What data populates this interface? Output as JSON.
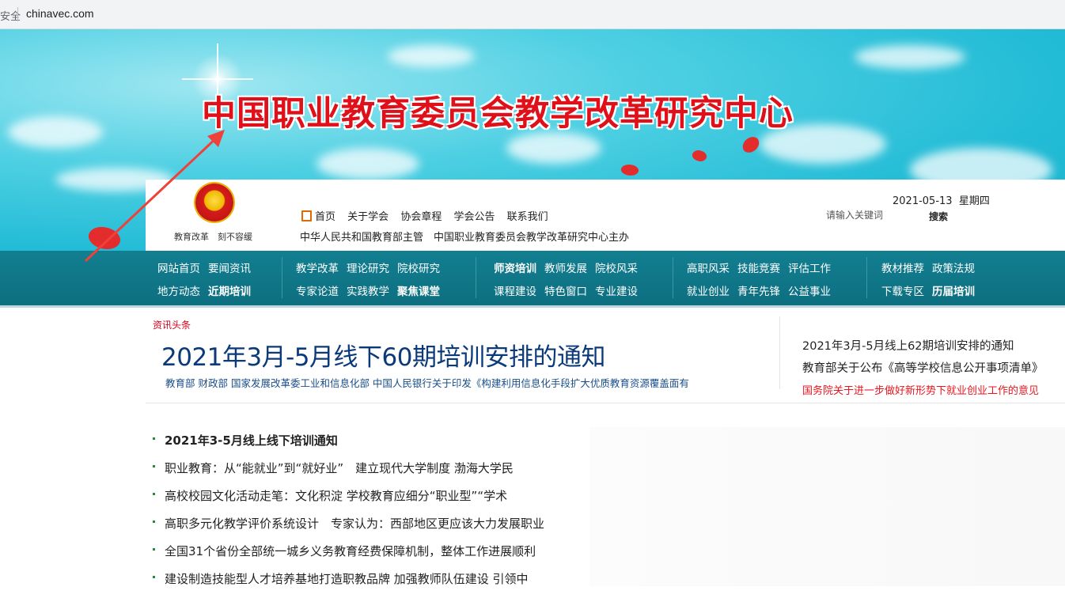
{
  "browser": {
    "security_text": "安全",
    "url": "chinavec.com"
  },
  "banner": {
    "title": "中国职业教育委员会教学改革研究中心"
  },
  "header": {
    "emblem_caption": "教育改革　刻不容缓",
    "nav": [
      {
        "label": "首页"
      },
      {
        "label": "关于学会"
      },
      {
        "label": "协会章程"
      },
      {
        "label": "学会公告"
      },
      {
        "label": "联系我们"
      }
    ],
    "sub_text": "中华人民共和国教育部主管　中国职业教育委员会教学改革研究中心主办",
    "date": "2021-05-13",
    "weekday": "星期四",
    "search_placeholder": "请输入关键词",
    "search_button": "搜索"
  },
  "navbar": {
    "groups": [
      {
        "row1": [
          "网站首页",
          "要闻资讯"
        ],
        "row2": [
          "地方动态",
          "近期培训"
        ]
      },
      {
        "row1": [
          "教学改革",
          "理论研究",
          "院校研究"
        ],
        "row2": [
          "专家论道",
          "实践教学",
          "聚焦课堂"
        ]
      },
      {
        "row1": [
          "师资培训",
          "教师发展",
          "院校风采"
        ],
        "row2": [
          "课程建设",
          "特色窗口",
          "专业建设"
        ]
      },
      {
        "row1": [
          "高职风采",
          "技能竞赛",
          "评估工作"
        ],
        "row2": [
          "就业创业",
          "青年先锋",
          "公益事业"
        ]
      },
      {
        "row1": [
          "教材推荐",
          "政策法规"
        ],
        "row2": [
          "下载专区",
          "历届培训"
        ]
      }
    ]
  },
  "headline": {
    "tag": "资讯头条",
    "title": "2021年3月-5月线下60期培训安排的通知",
    "subtitle": "教育部 财政部 国家发展改革委工业和信息化部 中国人民银行关于印发《构建利用信息化手段扩大优质教育资源覆盖面有"
  },
  "side_links": [
    "2021年3月-5月线上62期培训安排的通知",
    "教育部关于公布《高等学校信息公开事项清单》",
    "国务院关于进一步做好新形势下就业创业工作的意见"
  ],
  "news_list": [
    "2021年3-5月线上线下培训通知",
    "职业教育：从“能就业”到“就好业”　建立现代大学制度 渤海大学民",
    "高校校园文化活动走笔：文化积淀 学校教育应细分“职业型”“学术",
    "高职多元化教学评价系统设计　专家认为：西部地区更应该大力发展职业",
    "全国31个省份全部统一城乡义务教育经费保障机制，整体工作进展顺利",
    "建设制造技能型人才培养基地打造职教品牌 加强教师队伍建设 引领中"
  ]
}
